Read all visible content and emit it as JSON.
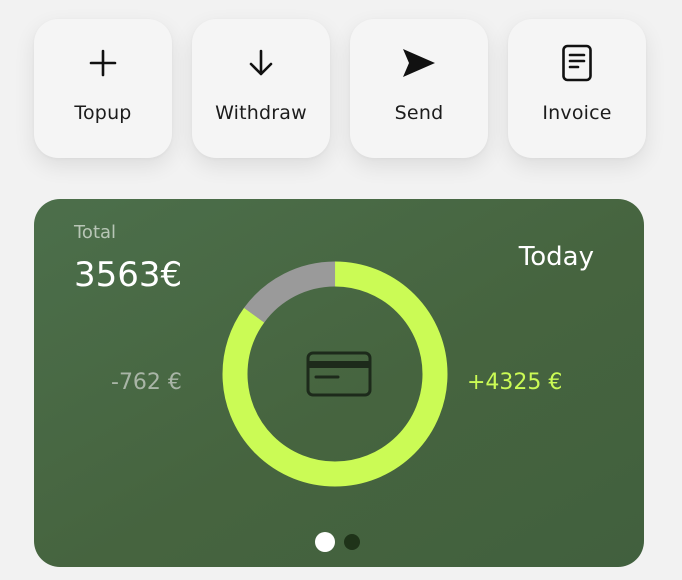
{
  "actions": [
    {
      "label": "Topup",
      "icon": "plus-icon"
    },
    {
      "label": "Withdraw",
      "icon": "arrow-down-icon"
    },
    {
      "label": "Send",
      "icon": "send-icon"
    },
    {
      "label": "Invoice",
      "icon": "invoice-icon"
    }
  ],
  "summary": {
    "total_label": "Total",
    "total_value": "3563€",
    "period": "Today",
    "outgoing": "-762 €",
    "incoming": "+4325 €",
    "center_icon": "credit-card-icon",
    "income_share": 0.85,
    "expense_share": 0.15
  },
  "colors": {
    "income": "#cbfb55",
    "expense": "#9a9a9a",
    "card_bg": "#4a6a46"
  },
  "pager": {
    "pages": 2,
    "active": 0
  }
}
